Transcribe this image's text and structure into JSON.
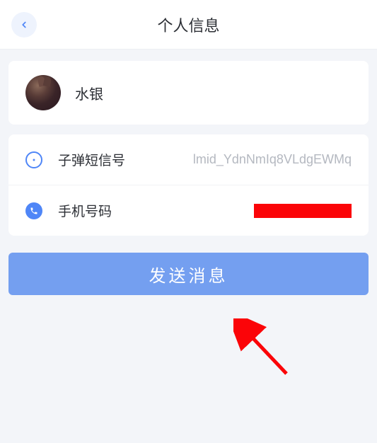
{
  "header": {
    "title": "个人信息"
  },
  "profile": {
    "name": "水银"
  },
  "info": {
    "sms_id": {
      "label": "子弹短信号",
      "value": "lmid_YdnNmIq8VLdgEWMq"
    },
    "phone": {
      "label": "手机号码"
    }
  },
  "actions": {
    "send_message": "发送消息"
  },
  "icons": {
    "back": "chevron-left-icon",
    "message": "message-icon",
    "phone": "phone-icon"
  }
}
